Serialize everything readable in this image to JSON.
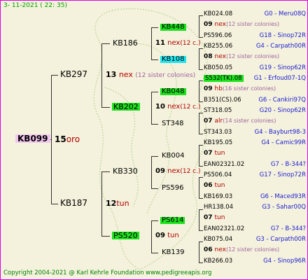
{
  "header": "3- 11-2021 ( 22: 35)",
  "footer": {
    "copyright": "Copyright 2004-2021 @ Karl Kehrle Foundation",
    "site": "www.pedigreeapis.org"
  },
  "root": {
    "id": "KB099",
    "num": "15",
    "colonies": "oro"
  },
  "gen1": [
    {
      "id": "KB297",
      "num": "13",
      "colonies": "nex",
      "note": "(12 sister colonies)"
    },
    {
      "id": "KB187",
      "num": "12",
      "colonies": "tun"
    }
  ],
  "gen2": [
    {
      "id": "KB186",
      "num": "11",
      "colonies": "nex",
      "note": "(12 c.)"
    },
    {
      "id": "KB202",
      "num": "10",
      "colonies": "nex",
      "note": "(12 c.)"
    },
    {
      "id": "KB330",
      "num": "09",
      "colonies": "nex",
      "note": "(12 c.)"
    },
    {
      "id": "PS520",
      "num": "09",
      "colonies": "tun"
    }
  ],
  "gen3": [
    "KB448",
    "KB108",
    "KB048",
    "ST348",
    "KB004",
    "PS596",
    "PS614",
    "KB139"
  ],
  "gen4": [
    {
      "top": "KB024.08",
      "topr": "G0 - Meru08Q",
      "num": "09",
      "col": "nex",
      "note": "(12 sister colonies)",
      "bot": "PS596.06",
      "botr": "G18 - Sinop72R"
    },
    {
      "top": "KB255.06",
      "topr": "G4 - Carpath00R",
      "num": "08",
      "col": "nex",
      "note": "(12 sister colonies)",
      "bot": "KB050.05",
      "botr": "G19 - Sinop62R"
    },
    {
      "top": "S532(TK).08",
      "topr": "G1 - Erfoud07-1Q",
      "num": "09",
      "col": "hb",
      "note": "(16 sister colonies)",
      "bot": "B351(CS).06",
      "botr": "G6 - Cankiri97Q"
    },
    {
      "top": "ST318.05",
      "topr": "G20 - Sinop62R",
      "num": "07",
      "col": "alr",
      "note": "(14 sister colonies)",
      "bot": "ST343.03",
      "botr": "G4 - Bayburt98-3"
    },
    {
      "top": "KB195.05",
      "topr": "G4 - Camic99R",
      "num": "07",
      "col": "tun",
      "note": "",
      "bot": "EAN02321.02",
      "botr": "G7 - B-344?"
    },
    {
      "top": "PS506.04",
      "topr": "G17 - Sinop72R",
      "num": "06",
      "col": "tun",
      "note": "",
      "bot": "KB169.03",
      "botr": "G6 - Maced93R"
    },
    {
      "top": "HR138.04",
      "topr": "G3 - Sahar00Q",
      "num": "07",
      "col": "tun",
      "note": "",
      "bot": "EAN02321.02",
      "botr": "G7 - B-344?"
    },
    {
      "top": "KB075.04",
      "topr": "G3 - Carpath00R",
      "num": "06",
      "col": "nex",
      "note": "(12 sister colonies)",
      "bot": "KB266.03",
      "botr": "G4 - Sinop96R"
    }
  ],
  "colors": {
    "border": "#e000e0",
    "highlight_green": "#1ee01e",
    "highlight_cyan": "#22e4ee",
    "highlight_pink": "#f3c6f0",
    "red": "#b00000",
    "blue": "#1a1ad0"
  }
}
